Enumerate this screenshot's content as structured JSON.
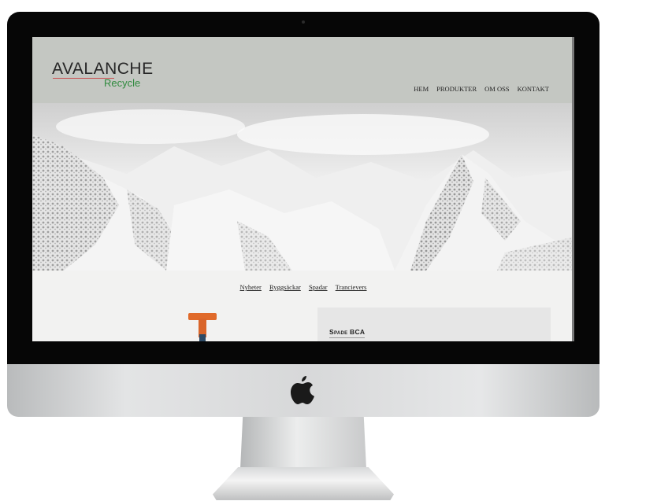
{
  "site": {
    "brand_main": "AVALANCHE",
    "brand_sub": "Recycle",
    "nav": [
      "HEM",
      "PRODUKTER",
      "OM OSS",
      "KONTAKT"
    ],
    "categories": [
      "Nyheter",
      "Ryggsäckar",
      "Spadar",
      "Trancievers"
    ],
    "product_title": "Spade BCA"
  },
  "colors": {
    "header_bg": "#c4c7c2",
    "brand_green": "#2f8a3e",
    "brand_red_underline": "#c94b4b",
    "panel_bg": "#e6e6e6",
    "shovel_orange": "#e06a2a"
  },
  "device": {
    "logo_icon": "apple-icon"
  }
}
